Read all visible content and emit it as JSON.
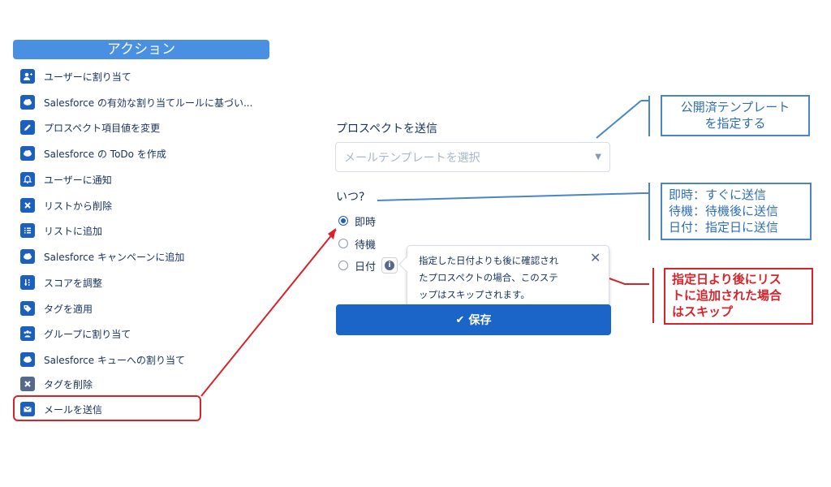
{
  "panel": {
    "header": "アクション",
    "items": [
      {
        "label": "ユーザーに割り当て",
        "icon": "user-add-icon"
      },
      {
        "label": "Salesforce の有効な割り当てルールに基づい...",
        "icon": "salesforce-cloud-icon"
      },
      {
        "label": "プロスペクト項目値を変更",
        "icon": "pencil-icon"
      },
      {
        "label": "Salesforce の ToDo を作成",
        "icon": "salesforce-cloud-icon"
      },
      {
        "label": "ユーザーに通知",
        "icon": "bell-icon"
      },
      {
        "label": "リストから削除",
        "icon": "x-icon"
      },
      {
        "label": "リストに追加",
        "icon": "list-icon"
      },
      {
        "label": "Salesforce キャンペーンに追加",
        "icon": "salesforce-cloud-icon"
      },
      {
        "label": "スコアを調整",
        "icon": "sort-score-icon"
      },
      {
        "label": "タグを適用",
        "icon": "tag-icon"
      },
      {
        "label": "グループに割り当て",
        "icon": "group-icon"
      },
      {
        "label": "Salesforce キューへの割り当て",
        "icon": "salesforce-cloud-icon"
      },
      {
        "label": "タグを削除",
        "icon": "x-icon"
      },
      {
        "label": "メールを送信",
        "icon": "envelope-icon"
      }
    ]
  },
  "form": {
    "title": "プロスペクトを送信",
    "template_placeholder": "メールテンプレートを選択",
    "when_label": "いつ?",
    "options": [
      {
        "label": "即時",
        "checked": true
      },
      {
        "label": "待機",
        "checked": false
      },
      {
        "label": "日付",
        "checked": false
      }
    ],
    "tooltip_lines": [
      "指定した日付よりも後に確認され",
      "たプロスペクトの場合、このステ",
      "ップはスキップされます。"
    ],
    "save_label": "保存"
  },
  "callouts": {
    "template": [
      "公開済テンプレート",
      "を指定する"
    ],
    "timing": [
      "即時：すぐに送信",
      "待機：待機後に送信",
      "日付：指定日に送信"
    ],
    "skip": [
      "指定日より後にリス",
      "トに追加された場合",
      "はスキップ"
    ]
  },
  "colors": {
    "brand_blue": "#1b64c8",
    "header_blue": "#4a90e2",
    "annotation_red": "#d9232a",
    "annotation_blue": "#4a86c5"
  }
}
